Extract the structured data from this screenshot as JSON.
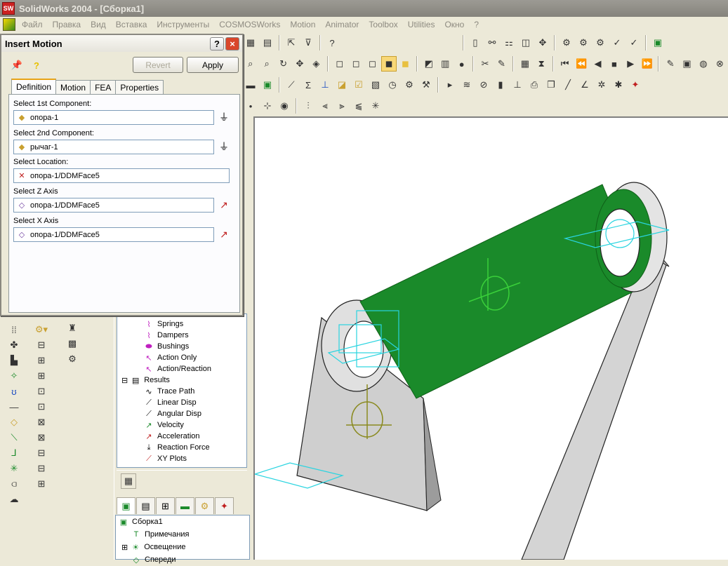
{
  "window": {
    "title": "SolidWorks 2004 - [Сборка1]",
    "app_icon": "SW"
  },
  "menu": [
    "Файл",
    "Правка",
    "Вид",
    "Вставка",
    "Инструменты",
    "COSMOSWorks",
    "Motion",
    "Animator",
    "Toolbox",
    "Utilities",
    "Окно",
    "?"
  ],
  "dialog": {
    "title": "Insert Motion",
    "help_label": "?",
    "close_label": "×",
    "revert_label": "Revert",
    "apply_label": "Apply",
    "tabs": [
      "Definition",
      "Motion",
      "FEA",
      "Properties"
    ],
    "active_tab": "Definition",
    "fields": [
      {
        "label": "Select 1st Component:",
        "value": "опора-1",
        "icon": "component-icon",
        "side": "ground-icon"
      },
      {
        "label": "Select 2nd Component:",
        "value": "рычаг-1",
        "icon": "component-icon",
        "side": "ground-icon"
      },
      {
        "label": "Select Location:",
        "value": "опора-1/DDMFace5",
        "icon": "location-icon",
        "side": ""
      },
      {
        "label": "Select Z Axis",
        "value": "опора-1/DDMFace5",
        "icon": "face-icon",
        "side": "direction-icon"
      },
      {
        "label": "Select X Axis",
        "value": "опора-1/DDMFace5",
        "icon": "face-icon",
        "side": "direction-icon"
      }
    ]
  },
  "tree_items": [
    {
      "label": "Springs",
      "indent": 2,
      "icon": "spring-icon"
    },
    {
      "label": "Dampers",
      "indent": 2,
      "icon": "damper-icon"
    },
    {
      "label": "Bushings",
      "indent": 2,
      "icon": "bushing-icon"
    },
    {
      "label": "Action Only",
      "indent": 2,
      "icon": "action-only-icon"
    },
    {
      "label": "Action/Reaction",
      "indent": 2,
      "icon": "action-reaction-icon"
    },
    {
      "label": "Results",
      "indent": 1,
      "icon": "results-icon",
      "expander": "⊟"
    },
    {
      "label": "Trace Path",
      "indent": 2,
      "icon": "trace-path-icon"
    },
    {
      "label": "Linear Disp",
      "indent": 2,
      "icon": "linear-disp-icon"
    },
    {
      "label": "Angular Disp",
      "indent": 2,
      "icon": "angular-disp-icon"
    },
    {
      "label": "Velocity",
      "indent": 2,
      "icon": "velocity-icon"
    },
    {
      "label": "Acceleration",
      "indent": 2,
      "icon": "acceleration-icon"
    },
    {
      "label": "Reaction Force",
      "indent": 2,
      "icon": "reaction-force-icon"
    },
    {
      "label": "XY Plots",
      "indent": 2,
      "icon": "xy-plots-icon"
    }
  ],
  "feature_tree": [
    {
      "label": "Сборка1",
      "icon": "assembly-icon",
      "expander": ""
    },
    {
      "label": "Примечания",
      "icon": "annotations-icon",
      "expander": ""
    },
    {
      "label": "Освещение",
      "icon": "lighting-icon",
      "expander": "⊞"
    },
    {
      "label": "Спереди",
      "icon": "plane-icon",
      "expander": ""
    }
  ],
  "colors": {
    "accent_green": "#1a8a2a",
    "selection_cyan": "#2ad4e0",
    "part_gray": "#d4d4d4"
  }
}
